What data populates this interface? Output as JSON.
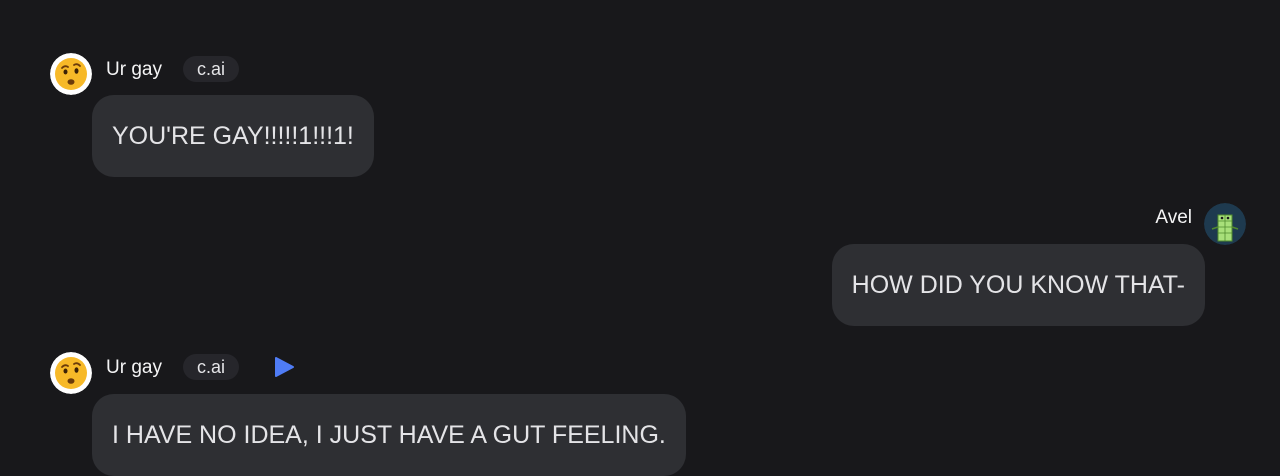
{
  "messages": [
    {
      "sender": "Ur gay",
      "badge": "c.ai",
      "text": "YOU'RE GAY!!!!!1!!!1!"
    },
    {
      "sender": "Avel",
      "text": "HOW DID YOU KNOW THAT-"
    },
    {
      "sender": "Ur gay",
      "badge": "c.ai",
      "text": "I HAVE NO IDEA, I JUST HAVE A GUT FEELING."
    }
  ],
  "icons": {
    "bot_avatar": "raised-eyebrow-face-emoji",
    "user_avatar": "green-block-character",
    "play": "play-icon"
  },
  "colors": {
    "background": "#18181b",
    "bubble": "#2e2f33",
    "badge": "#26262b",
    "play": "#4f7cf5"
  }
}
